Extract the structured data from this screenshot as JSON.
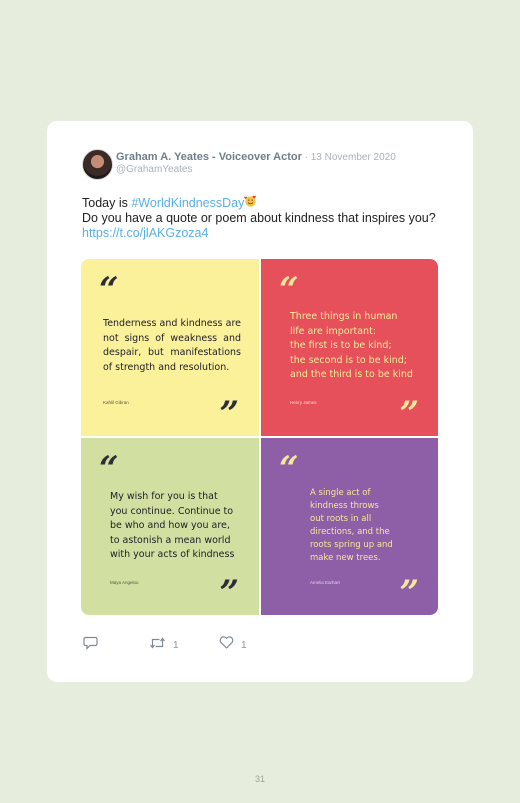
{
  "tweet": {
    "display_name": "Graham A. Yeates - Voiceover Actor",
    "date_separator": " · ",
    "date": "13 November 2020",
    "handle": "@GrahamYeates",
    "text_intro": "Today is ",
    "hashtag": "#WorldKindnessDay",
    "emoji_icon": "smiling-face-with-hearts-icon",
    "text_question": "Do you have a quote or poem about kindness that inspires you? ",
    "link": "https://t.co/jlAKGzoza4"
  },
  "quotes": [
    {
      "text": "Tenderness and kindness are not signs of weakness and despair, but manifestations of strength and resolution.",
      "attribution": "Kahlil Gibran",
      "bg": "#fbf19b"
    },
    {
      "lines": [
        "Three things in human",
        "life are important:",
        "the first is to be kind;",
        "the second is to be kind;",
        "and the third is to be kind"
      ],
      "attribution": "Henry James",
      "bg": "#e5505a"
    },
    {
      "lines": [
        "My wish for you is that",
        "you continue. Continue to",
        "be who and how you are,",
        "to astonish a mean world",
        "with your acts of kindness"
      ],
      "attribution": "Maya Angelou",
      "bg": "#d1e0a1"
    },
    {
      "lines": [
        "A single act of",
        "kindness throws",
        "out roots in all",
        "directions, and the",
        "roots spring up and",
        "make new trees."
      ],
      "attribution": "Amelia Earhart",
      "bg": "#8e5fa7"
    }
  ],
  "actions": {
    "reply_icon": "reply-icon",
    "retweet_icon": "retweet-icon",
    "retweet_count": "1",
    "like_icon": "heart-icon",
    "like_count": "1"
  },
  "page_number": "31",
  "colors": {
    "page_background": "#e7eddd",
    "link": "#58b0e5",
    "card": "#ffffff"
  }
}
